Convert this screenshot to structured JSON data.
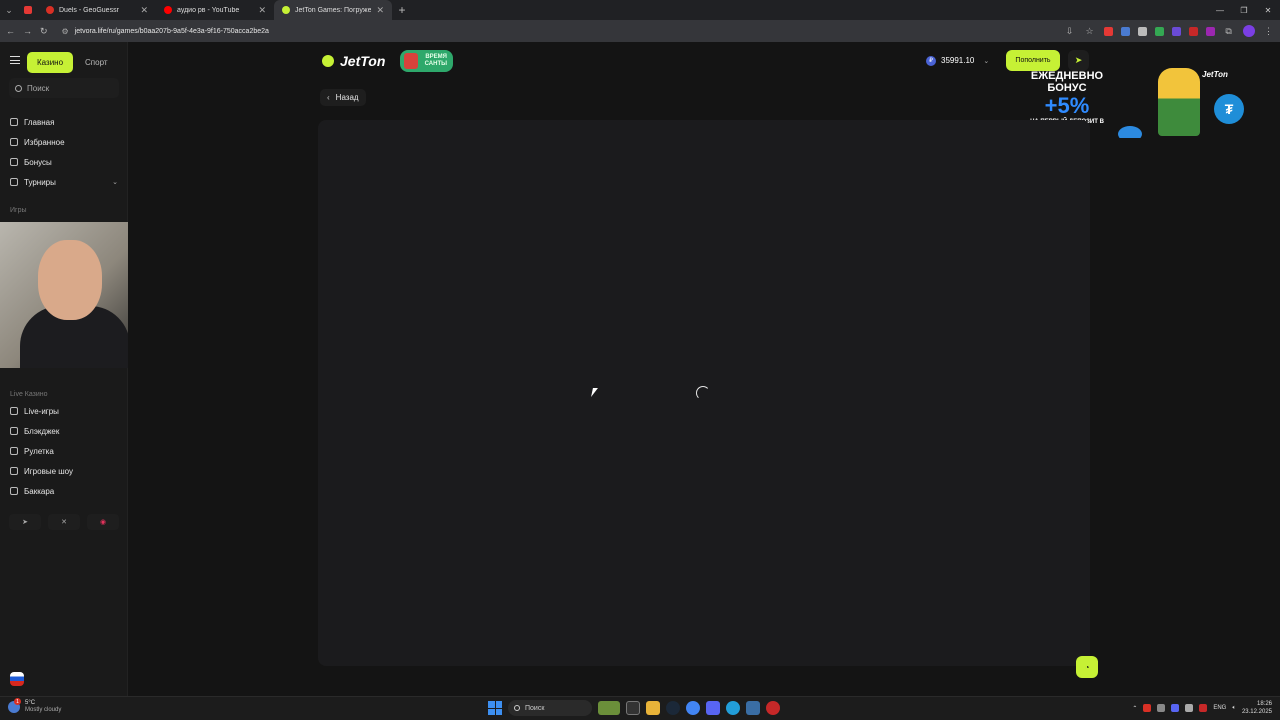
{
  "browser": {
    "tabs": [
      {
        "title": "Duels - GeoGuessr",
        "favicon_color": "#d93025",
        "active": false
      },
      {
        "title": "аудио рв - YouTube",
        "favicon_color": "#ff0000",
        "active": false
      },
      {
        "title": "JetTon Games: Погружени",
        "favicon_color": "#c6f135",
        "active": true
      }
    ],
    "url": "jetvora.life/ru/games/b0aa207b-9a5f-4e3a-9f16-750acca2be2a",
    "new_tab_label": "+"
  },
  "sidebar": {
    "mode_tabs": [
      "Казино",
      "Спорт"
    ],
    "search_placeholder": "Поиск",
    "nav_items": [
      {
        "label": "Главная",
        "icon": "home-icon"
      },
      {
        "label": "Избранное",
        "icon": "star-icon"
      },
      {
        "label": "Бонусы",
        "icon": "gift-icon"
      },
      {
        "label": "Турниры",
        "icon": "trophy-icon"
      }
    ],
    "games_section": "Игры",
    "live_section": "Live Казино",
    "live_items": [
      {
        "label": "Live-игры",
        "icon": "live-icon"
      },
      {
        "label": "Блэкджек",
        "icon": "cards-icon"
      },
      {
        "label": "Рулетка",
        "icon": "roulette-icon"
      },
      {
        "label": "Игровые шоу",
        "icon": "show-icon"
      },
      {
        "label": "Баккара",
        "icon": "baccarat-icon"
      }
    ],
    "socials": [
      "telegram-icon",
      "x-icon",
      "instagram-icon"
    ]
  },
  "header": {
    "brand": "JetTon",
    "promo_badge": "ВРЕМЯ САНТЫ",
    "balance": "35991.10",
    "currency_symbol": "₽",
    "deposit_label": "Пополнить"
  },
  "banner": {
    "line1": "ЕЖЕДНЕВНО",
    "line2": "БОНУС",
    "percent": "+5%",
    "line3": "НА ПЕРВЫЙ ДЕПОЗИТ В КРИПТЕ",
    "brand": "JetTon",
    "token_symbol": "₮"
  },
  "main": {
    "back_label": "Назад"
  },
  "taskbar": {
    "weather_temp": "5°C",
    "weather_desc": "Mostly cloudy",
    "search_placeholder": "Поиск",
    "lang": "ENG",
    "time": "18:26",
    "date": "23.12.2025",
    "notification_count": "1"
  },
  "colors": {
    "accent": "#c6f135",
    "background": "#141414",
    "sidebar": "#1a1a1a",
    "panel": "#1b1b1d"
  }
}
